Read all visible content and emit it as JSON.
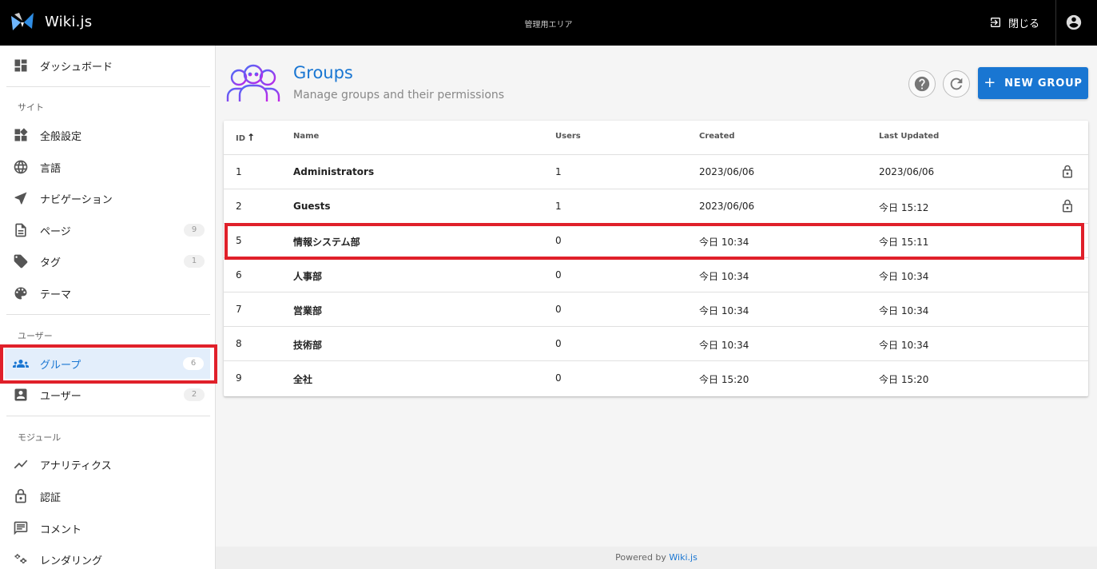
{
  "header": {
    "brand": "Wiki.js",
    "center_title": "管理用エリア",
    "close_label": "閉じる"
  },
  "sidebar": {
    "items": [
      {
        "label": "ダッシュボード",
        "icon": "dashboard-icon"
      },
      {
        "label": "全般設定",
        "icon": "widgets-icon"
      },
      {
        "label": "言語",
        "icon": "globe-icon"
      },
      {
        "label": "ナビゲーション",
        "icon": "navigation-arrow-icon"
      },
      {
        "label": "ページ",
        "icon": "page-icon",
        "badge": "9"
      },
      {
        "label": "タグ",
        "icon": "tag-icon",
        "badge": "1"
      },
      {
        "label": "テーマ",
        "icon": "palette-icon"
      },
      {
        "label": "グループ",
        "icon": "group-icon",
        "badge": "6"
      },
      {
        "label": "ユーザー",
        "icon": "user-card-icon",
        "badge": "2"
      },
      {
        "label": "アナリティクス",
        "icon": "analytics-icon"
      },
      {
        "label": "認証",
        "icon": "lock-icon"
      },
      {
        "label": "コメント",
        "icon": "comment-icon"
      },
      {
        "label": "レンダリング",
        "icon": "cogs-icon"
      }
    ],
    "sections": {
      "site": "サイト",
      "users": "ユーザー",
      "modules": "モジュール"
    }
  },
  "page": {
    "title": "Groups",
    "subtitle": "Manage groups and their permissions",
    "new_group_label": "NEW GROUP"
  },
  "table": {
    "columns": {
      "id": "ID",
      "name": "Name",
      "users": "Users",
      "created": "Created",
      "updated": "Last Updated"
    },
    "rows": [
      {
        "id": "1",
        "name": "Administrators",
        "users": "1",
        "created": "2023/06/06",
        "updated": "2023/06/06",
        "locked": true
      },
      {
        "id": "2",
        "name": "Guests",
        "users": "1",
        "created": "2023/06/06",
        "updated": "今日 15:12",
        "locked": true
      },
      {
        "id": "5",
        "name": "情報システム部",
        "users": "0",
        "created": "今日 10:34",
        "updated": "今日 15:11",
        "locked": false
      },
      {
        "id": "6",
        "name": "人事部",
        "users": "0",
        "created": "今日 10:34",
        "updated": "今日 10:34",
        "locked": false
      },
      {
        "id": "7",
        "name": "営業部",
        "users": "0",
        "created": "今日 10:34",
        "updated": "今日 10:34",
        "locked": false
      },
      {
        "id": "8",
        "name": "技術部",
        "users": "0",
        "created": "今日 10:34",
        "updated": "今日 10:34",
        "locked": false
      },
      {
        "id": "9",
        "name": "全社",
        "users": "0",
        "created": "今日 15:20",
        "updated": "今日 15:20",
        "locked": false
      }
    ]
  },
  "footer": {
    "prefix": "Powered by",
    "link": "Wiki.js"
  },
  "colors": {
    "accent": "#1976d2",
    "highlight": "#e0202a",
    "topbar": "#000000"
  }
}
